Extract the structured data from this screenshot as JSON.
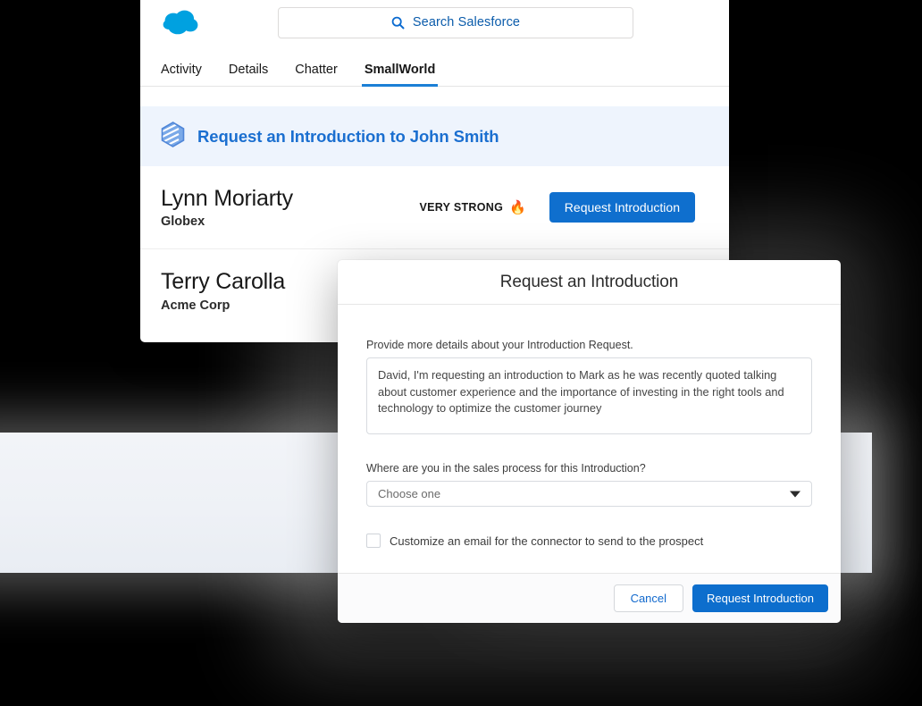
{
  "app": {
    "logo_icon": "salesforce-cloud-icon",
    "brand_color": "#00A1E0",
    "accent_color": "#0f6fce",
    "banner_bg": "#eef4fd"
  },
  "search": {
    "icon": "search-icon",
    "placeholder": "Search Salesforce",
    "value": "Search Salesforce"
  },
  "tabs": [
    {
      "label": "Activity",
      "active": false
    },
    {
      "label": "Details",
      "active": false
    },
    {
      "label": "Chatter",
      "active": false
    },
    {
      "label": "SmallWorld",
      "active": true
    }
  ],
  "banner": {
    "icon": "smallworld-hexagon-icon",
    "title": "Request an Introduction to John Smith"
  },
  "contacts": [
    {
      "name": "Lynn Moriarty",
      "company": "Globex",
      "strength_label": "VERY STRONG",
      "strength_emoji": "🔥",
      "action_label": "Request Introduction"
    },
    {
      "name": "Terry Carolla",
      "company": "Acme Corp",
      "strength_label": "",
      "strength_emoji": "",
      "action_label": ""
    }
  ],
  "modal": {
    "title": "Request an Introduction",
    "details_label": "Provide more details about your Introduction Request.",
    "details_value": "David, I'm requesting an introduction to Mark as he was recently quoted talking about customer experience and the importance of investing in the right tools and technology to optimize the customer journey",
    "details_placeholder": "Provide more details about your Introduction Request.",
    "sales_process_label": "Where are you in the sales process for this Introduction?",
    "sales_process_value": "Choose one",
    "sales_process_options": [
      "Choose one"
    ],
    "checkbox_label": "Customize an email for the connector to send to the prospect",
    "checkbox_checked": false,
    "cancel_label": "Cancel",
    "submit_label": "Request Introduction"
  }
}
